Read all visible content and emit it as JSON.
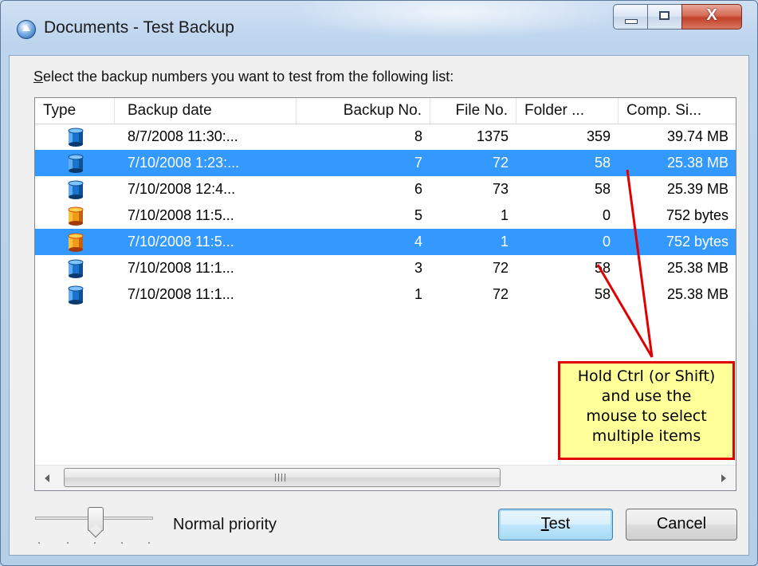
{
  "window": {
    "title": "Documents - Test Backup",
    "controls": {
      "close_label": "X"
    }
  },
  "prompt": {
    "accel": "S",
    "rest": "elect the backup numbers you want to test from the following list:"
  },
  "list": {
    "columns": [
      "Type",
      "Backup date",
      "Backup No.",
      "File No.",
      "Folder ...",
      "Comp. Si..."
    ],
    "rows": [
      {
        "icon": "database-blue-icon",
        "date": "8/7/2008 11:30:...",
        "backup_no": "8",
        "file_no": "1375",
        "folder": "359",
        "size": "39.74 MB",
        "selected": false
      },
      {
        "icon": "database-blue-icon",
        "date": "7/10/2008 1:23:...",
        "backup_no": "7",
        "file_no": "72",
        "folder": "58",
        "size": "25.38 MB",
        "selected": true
      },
      {
        "icon": "database-blue-icon",
        "date": "7/10/2008 12:4...",
        "backup_no": "6",
        "file_no": "73",
        "folder": "58",
        "size": "25.39 MB",
        "selected": false
      },
      {
        "icon": "database-orange-icon",
        "date": "7/10/2008 11:5...",
        "backup_no": "5",
        "file_no": "1",
        "folder": "0",
        "size": "752 bytes",
        "selected": false
      },
      {
        "icon": "database-orange-icon",
        "date": "7/10/2008 11:5...",
        "backup_no": "4",
        "file_no": "1",
        "folder": "0",
        "size": "752 bytes",
        "selected": true
      },
      {
        "icon": "database-blue-icon",
        "date": "7/10/2008 11:1...",
        "backup_no": "3",
        "file_no": "72",
        "folder": "58",
        "size": "25.38 MB",
        "selected": false
      },
      {
        "icon": "database-blue-icon",
        "date": "7/10/2008 11:1...",
        "backup_no": "1",
        "file_no": "72",
        "folder": "58",
        "size": "25.38 MB",
        "selected": false
      }
    ]
  },
  "callout": {
    "text": "Hold Ctrl (or Shift)\nand use the\nmouse to select\nmultiple items"
  },
  "priority": {
    "label": "Normal priority"
  },
  "buttons": {
    "test_accel": "T",
    "test_rest": "est",
    "cancel": "Cancel"
  },
  "colors": {
    "selection": "#3399ff",
    "callout_fill": "#ffff99",
    "callout_border": "#e00000"
  }
}
